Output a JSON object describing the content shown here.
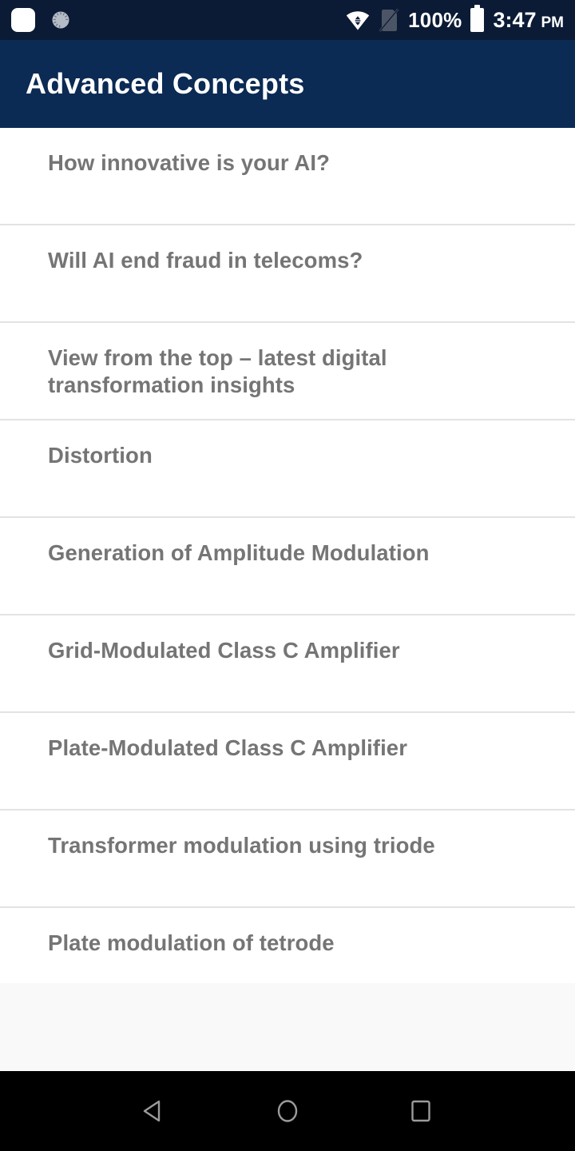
{
  "status_bar": {
    "background": "#0b1b36",
    "icons_left": [
      {
        "name": "notification-icon",
        "glyph": "rounded-square"
      },
      {
        "name": "sync-spinner-icon",
        "glyph": "circle-spinner"
      }
    ],
    "icons_right": [
      {
        "name": "wifi-icon",
        "glyph": "wifi-data"
      },
      {
        "name": "sim-card-off-icon",
        "glyph": "sim-crossed"
      }
    ],
    "battery_percent": "100%",
    "battery_icon": "battery-full-icon",
    "time": "3:47",
    "meridiem": "PM"
  },
  "app_bar": {
    "title": "Advanced Concepts",
    "background": "#0b2a54",
    "text_color": "#ffffff"
  },
  "list": {
    "text_color": "#757575",
    "divider_color": "#e3e3e3",
    "items": [
      {
        "label": "How innovative is your AI?"
      },
      {
        "label": "Will AI end fraud in telecoms?"
      },
      {
        "label": "View from the top – latest digital transformation insights"
      },
      {
        "label": "Distortion"
      },
      {
        "label": "Generation of Amplitude Modulation"
      },
      {
        "label": "Grid-Modulated Class C Amplifier"
      },
      {
        "label": "Plate-Modulated Class C Amplifier"
      },
      {
        "label": "Transformer modulation using triode"
      },
      {
        "label": "Plate modulation of tetrode"
      }
    ]
  },
  "nav_bar": {
    "background": "#000000",
    "buttons": [
      {
        "name": "back-button",
        "icon": "back-triangle-icon"
      },
      {
        "name": "home-button",
        "icon": "home-circle-icon"
      },
      {
        "name": "recents-button",
        "icon": "recents-square-icon"
      }
    ]
  }
}
